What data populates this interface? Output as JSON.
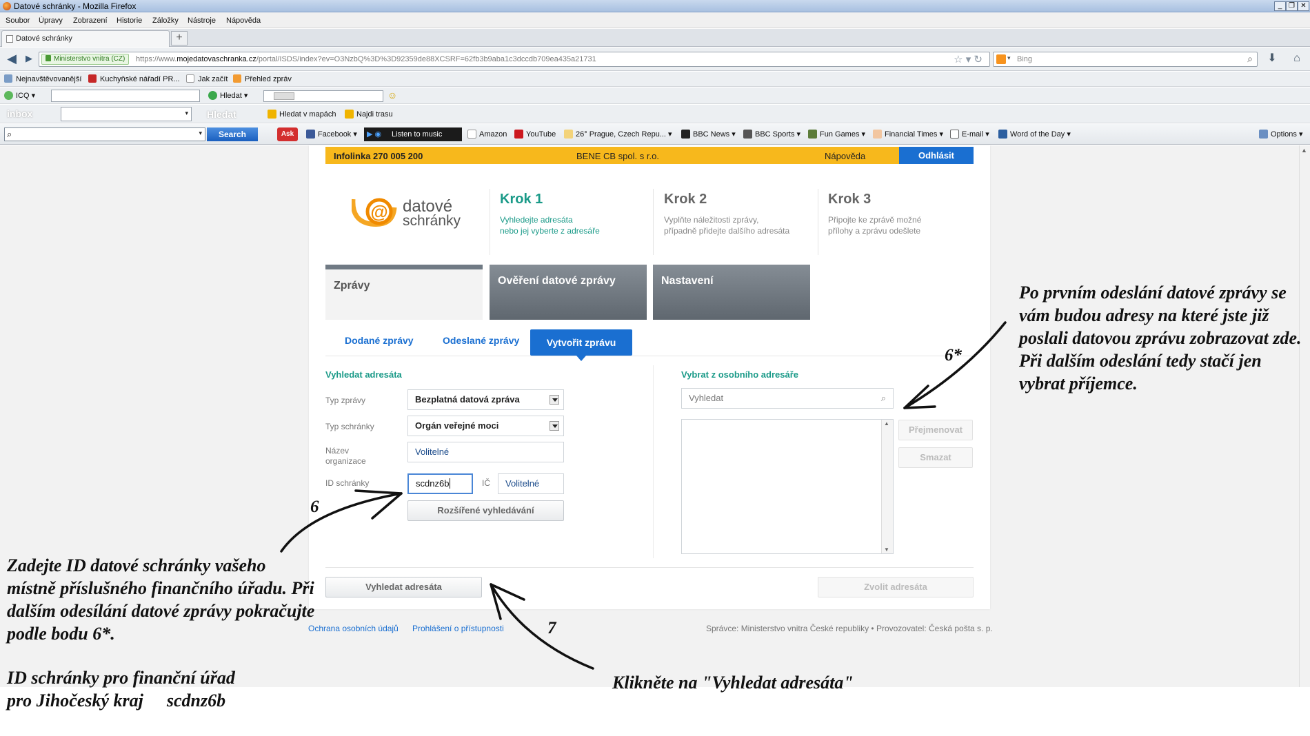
{
  "window": {
    "title": "Datové schránky - Mozilla Firefox"
  },
  "menu": [
    "Soubor",
    "Úpravy",
    "Zobrazení",
    "Historie",
    "Záložky",
    "Nástroje",
    "Nápověda"
  ],
  "tab": {
    "label": "Datové schránky"
  },
  "address": {
    "identity": "Ministerstvo vnitra (CZ)",
    "url_prefix": "https://www.",
    "url_domain": "mojedatovaschranka.cz",
    "url_rest": "/portal/ISDS/index?ev=O3NzbQ%3D%3D92359de88XCSRF=62fb3b9aba1c3dccdb709ea435a21731"
  },
  "search": {
    "placeholder": "Bing"
  },
  "bookmarks": [
    "Nejnavštěvovanější",
    "Kuchyňské nářadí PR...",
    "Jak začít",
    "Přehled zpráv"
  ],
  "icq_bar": {
    "label": "ICQ",
    "search": "Hledat"
  },
  "inbox_bar": {
    "logo": "inbox",
    "search": "Hledat",
    "maps": "Hledat v mapách",
    "route": "Najdi trasu"
  },
  "ask_bar": {
    "search": "Search",
    "music": "Listen to music",
    "items": [
      "Facebook",
      "Amazon",
      "YouTube",
      "26° Prague, Czech Repu...",
      "BBC News",
      "BBC Sports",
      "Fun Games",
      "Financial Times",
      "E-mail",
      "Word of the Day"
    ],
    "options": "Options"
  },
  "site": {
    "infoline": "Infolinka 270 005 200",
    "company": "BENE CB spol. s r.o.",
    "help": "Nápověda",
    "logout": "Odhlásit",
    "logo": {
      "line1": "datové",
      "line2": "schránky"
    },
    "steps": [
      {
        "title": "Krok 1",
        "line1": "Vyhledejte adresáta",
        "line2": "nebo jej vyberte z adresáře"
      },
      {
        "title": "Krok 2",
        "line1": "Vyplňte náležitosti zprávy,",
        "line2": "případně přidejte dalšího adresáta"
      },
      {
        "title": "Krok 3",
        "line1": "Připojte ke zprávě možné",
        "line2": "přílohy a zprávu odešlete"
      }
    ],
    "main_tabs": [
      "Zprávy",
      "Ověření datové zprávy",
      "Nastavení"
    ],
    "sub_tabs": [
      "Dodané zprávy",
      "Odeslané zprávy",
      "Vytvořit zprávu"
    ],
    "search_section": {
      "heading": "Vyhledat adresáta",
      "type_label": "Typ zprávy",
      "type_value": "Bezplatná datová zpráva",
      "box_type_label": "Typ schránky",
      "box_type_value": "Orgán veřejné moci",
      "org_label_1": "Název",
      "org_label_2": "organizace",
      "org_placeholder": "Volitelné",
      "id_label": "ID schránky",
      "id_value": "scdnz6b",
      "ic_label": "IČ",
      "ic_placeholder": "Volitelné",
      "advanced": "Rozšířené vyhledávání",
      "search_button": "Vyhledat adresáta"
    },
    "addressbook": {
      "heading": "Vybrat z osobního adresáře",
      "placeholder": "Vyhledat",
      "rename": "Přejmenovat",
      "delete": "Smazat",
      "choose": "Zvolit adresáta"
    },
    "footer": {
      "privacy": "Ochrana osobních údajů",
      "accessibility": "Prohlášení o přístupnosti",
      "admin": "Správce: Ministerstvo vnitra České republiky • Provozovatel: Česká pošta s. p."
    }
  },
  "annotations": {
    "right": "Po prvním odeslání datové zprávy se vám budou adresy na které jste již poslali datovou zprávu zobrazovat zde. Při dalším odeslání tedy stačí jen vybrat příjemce.",
    "right_num": "6*",
    "left": "Zadejte ID datové schránky vašeho místně příslušného finančního úřadu. Při dalším odesílání datové zprávy pokračujte podle bodu 6*.",
    "left_num": "6",
    "left2_line1": "ID schránky pro finanční úřad",
    "left2_line2": "pro Jihočeský kraj",
    "left2_id": "scdnz6b",
    "bottom": "Klikněte na \"Vyhledat adresáta\"",
    "bottom_num": "7"
  },
  "colors": {
    "accent_blue": "#1a6fd1",
    "step_teal": "#1a9a88",
    "strip_yellow": "#f7b81c",
    "logo_orange": "#f5a623"
  }
}
